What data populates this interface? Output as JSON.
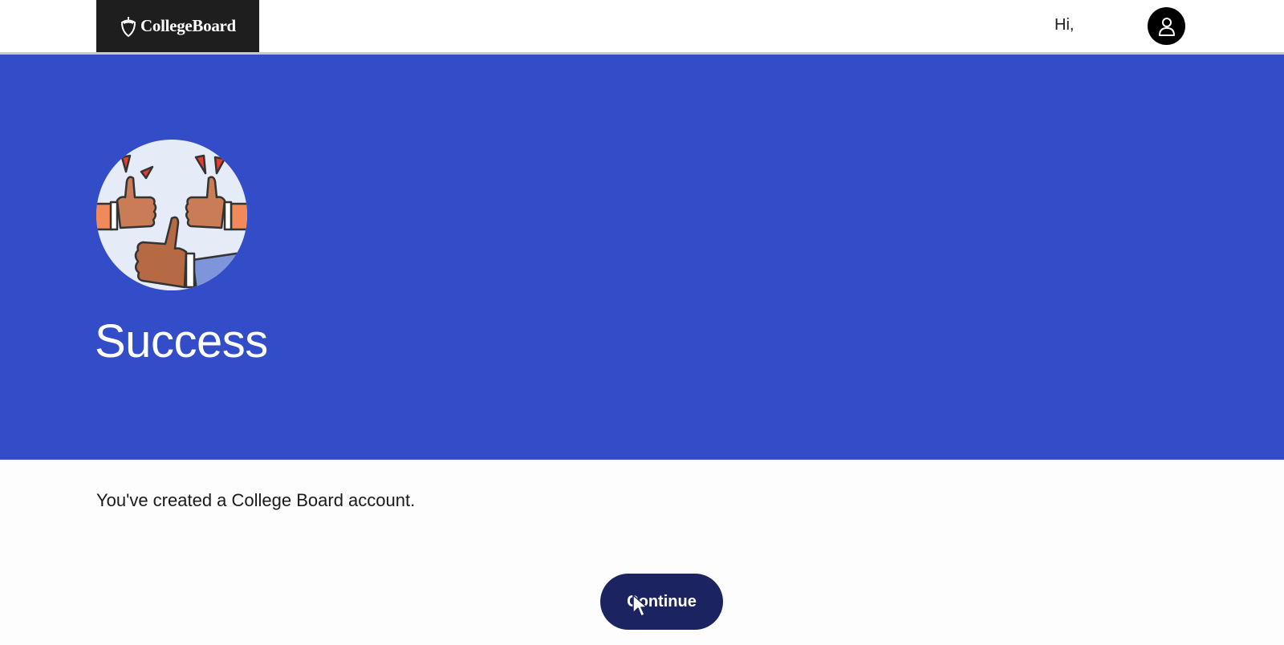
{
  "header": {
    "logo_text": "CollegeBoard",
    "greeting": "Hi,",
    "avatar_icon": "user-icon"
  },
  "hero": {
    "illustration": "thumbs-up-celebration",
    "title": "Success"
  },
  "main": {
    "message": "You've created a College Board account.",
    "continue_label": "Continue"
  },
  "colors": {
    "hero_background": "#324dc7",
    "button_background": "#1b2460",
    "logo_background": "#1f1e1e"
  }
}
